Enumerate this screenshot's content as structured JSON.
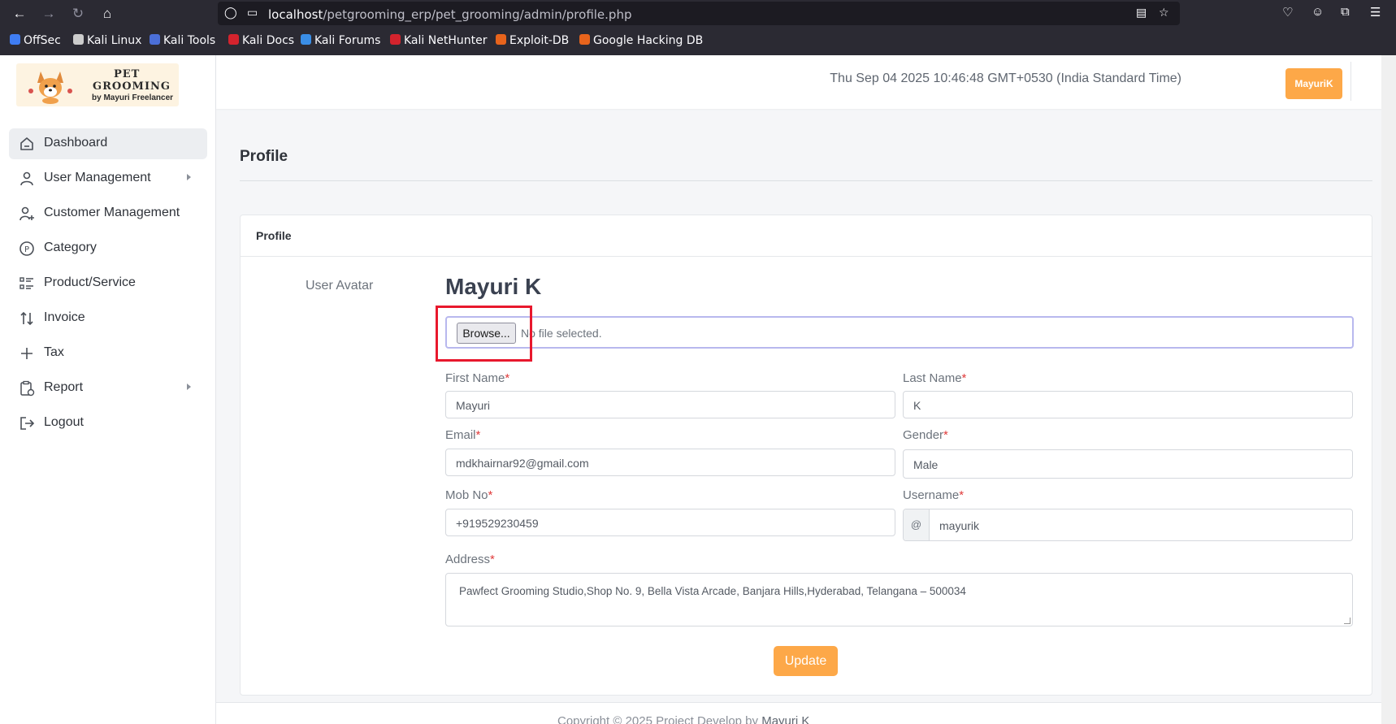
{
  "browser": {
    "url_host": "localhost",
    "url_path": "/petgrooming_erp/pet_grooming/admin/profile.php",
    "bookmarks": [
      {
        "label": "OffSec",
        "color": "#3f7df3"
      },
      {
        "label": "Kali Linux",
        "color": "#cccccc"
      },
      {
        "label": "Kali Tools",
        "color": "#4b6fd8"
      },
      {
        "label": "Kali Docs",
        "color": "#d4232d"
      },
      {
        "label": "Kali Forums",
        "color": "#3a8ee6"
      },
      {
        "label": "Kali NetHunter",
        "color": "#d4232d"
      },
      {
        "label": "Exploit-DB",
        "color": "#e8641c"
      },
      {
        "label": "Google Hacking DB",
        "color": "#e8641c"
      }
    ]
  },
  "logo": {
    "line1": "PET",
    "line2": "GROOMING",
    "line3": "by Mayuri Freelancer"
  },
  "sidebar": {
    "items": [
      {
        "label": "Dashboard",
        "icon": "home-icon",
        "active": true
      },
      {
        "label": "User Management",
        "icon": "user-icon",
        "submenu": true
      },
      {
        "label": "Customer Management",
        "icon": "user-plus-icon"
      },
      {
        "label": "Category",
        "icon": "category-p-icon"
      },
      {
        "label": "Product/Service",
        "icon": "list-icon"
      },
      {
        "label": "Invoice",
        "icon": "sort-arrows-icon"
      },
      {
        "label": "Tax",
        "icon": "plus-icon"
      },
      {
        "label": "Report",
        "icon": "clipboard-icon",
        "submenu": true
      },
      {
        "label": "Logout",
        "icon": "logout-icon"
      }
    ]
  },
  "header": {
    "datetime": "Thu Sep 04 2025 10:46:48 GMT+0530 (India Standard Time)",
    "user_button": "MayuriK"
  },
  "page": {
    "title": "Profile",
    "card_title": "Profile",
    "avatar_label": "User Avatar",
    "full_name": "Mayuri K",
    "browse_label": "Browse...",
    "file_status": "No file selected.",
    "update_label": "Update"
  },
  "form": {
    "first_name": {
      "label": "First Name",
      "value": "Mayuri"
    },
    "last_name": {
      "label": "Last Name",
      "value": "K"
    },
    "email": {
      "label": "Email",
      "value": "mdkhairnar92@gmail.com"
    },
    "gender": {
      "label": "Gender",
      "value": "Male"
    },
    "mobile": {
      "label": "Mob No",
      "value": "+919529230459"
    },
    "username": {
      "label": "Username",
      "prefix": "@",
      "value": "mayurik"
    },
    "address": {
      "label": "Address",
      "value": "Pawfect Grooming Studio,Shop No. 9, Bella Vista Arcade, Banjara Hills,Hyderabad, Telangana – 500034"
    },
    "required_mark": "*"
  },
  "footer": {
    "text": "Copyright © 2025 Project Develop by",
    "author": "Mayuri K"
  },
  "colors": {
    "accent": "#fda848",
    "highlight_box": "#e8182d"
  }
}
